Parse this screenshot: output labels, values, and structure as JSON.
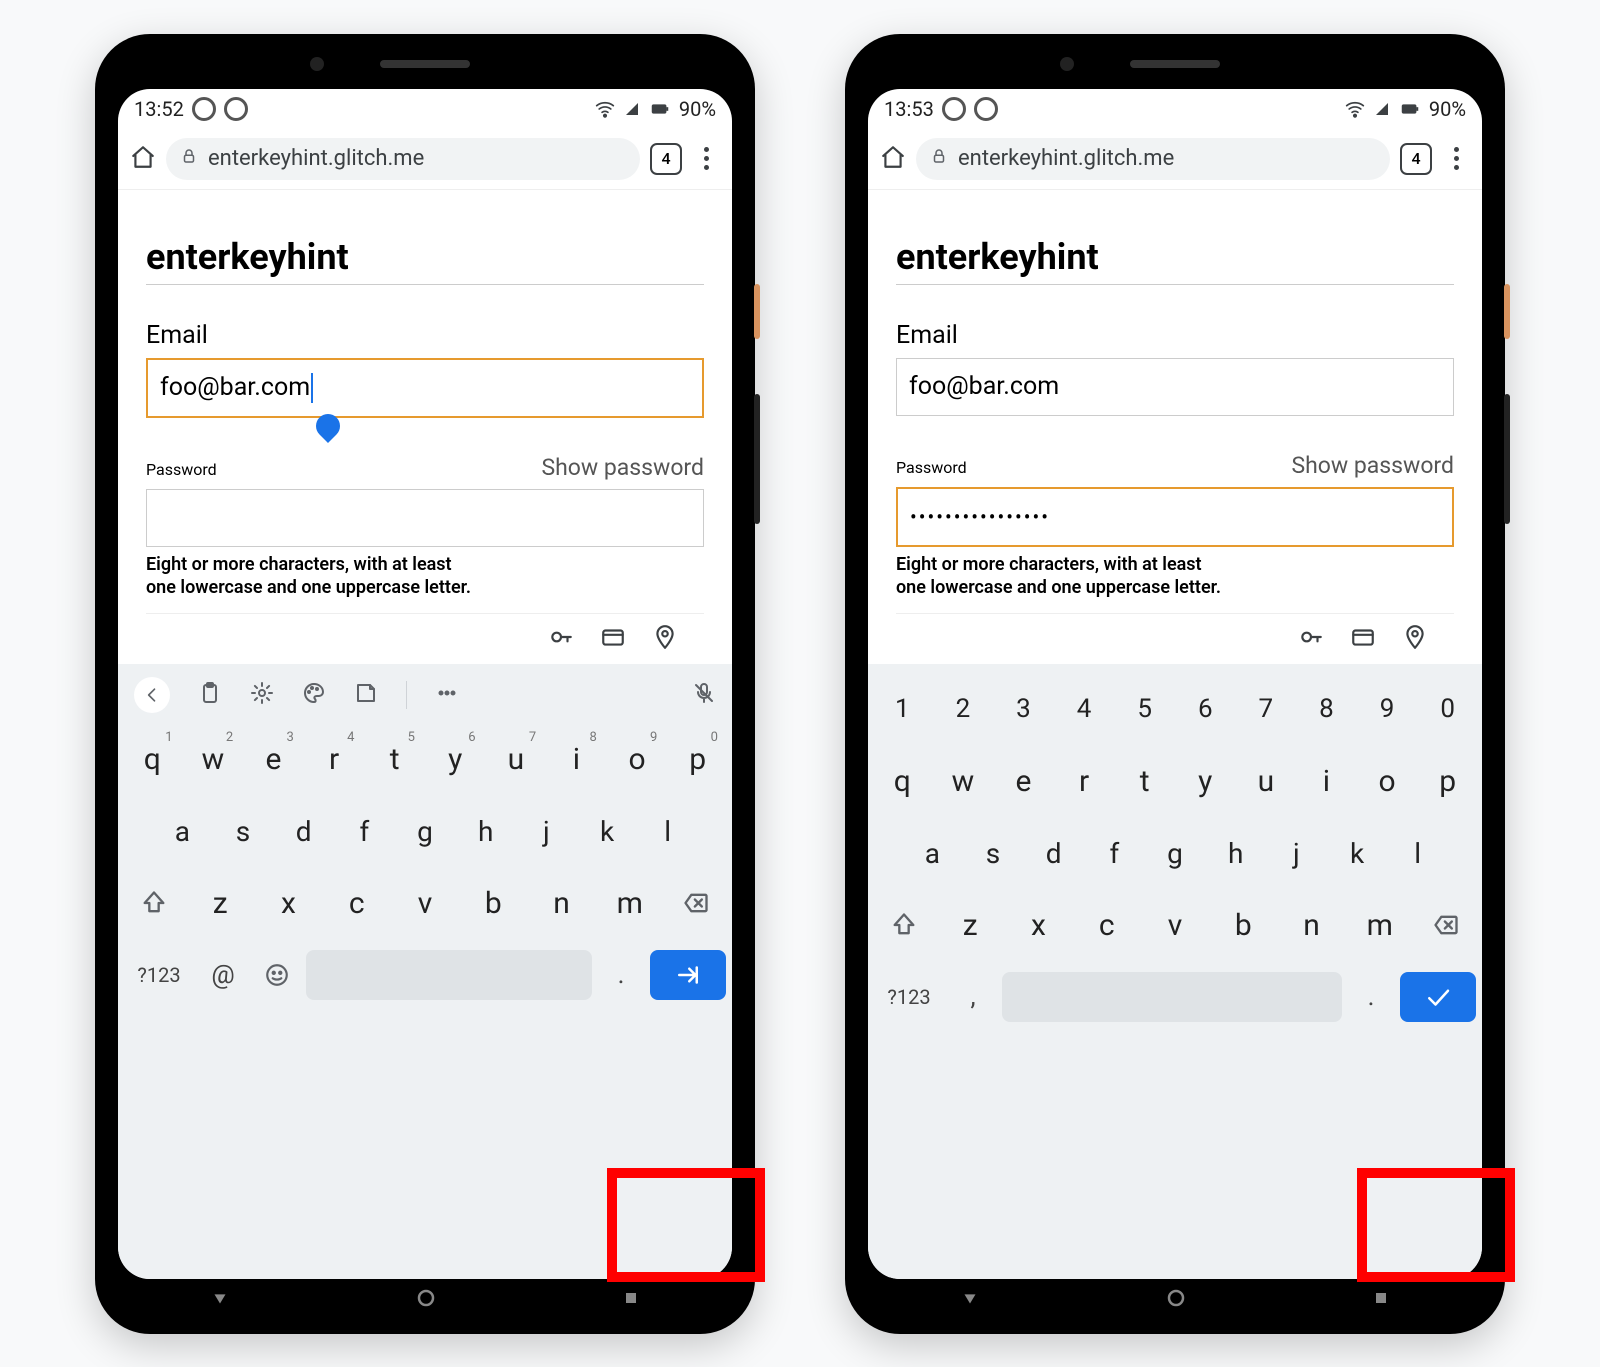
{
  "phones": [
    {
      "status": {
        "time": "13:52",
        "battery": "90%"
      },
      "toolbar": {
        "url": "enterkeyhint.glitch.me",
        "tab_count": "4"
      },
      "page": {
        "title": "enterkeyhint",
        "email_label": "Email",
        "email_value": "foo@bar.com",
        "password_label": "Password",
        "show_password": "Show password",
        "password_value": "",
        "password_hint_l1": "Eight or more characters, with at least",
        "password_hint_l2": "one lowercase and one uppercase letter.",
        "email_active": true,
        "password_active": false
      },
      "keyboard": {
        "mode": "email",
        "row1": [
          {
            "k": "q",
            "s": "1"
          },
          {
            "k": "w",
            "s": "2"
          },
          {
            "k": "e",
            "s": "3"
          },
          {
            "k": "r",
            "s": "4"
          },
          {
            "k": "t",
            "s": "5"
          },
          {
            "k": "y",
            "s": "6"
          },
          {
            "k": "u",
            "s": "7"
          },
          {
            "k": "i",
            "s": "8"
          },
          {
            "k": "o",
            "s": "9"
          },
          {
            "k": "p",
            "s": "0"
          }
        ],
        "row2": [
          "a",
          "s",
          "d",
          "f",
          "g",
          "h",
          "j",
          "k",
          "l"
        ],
        "row3": [
          "z",
          "x",
          "c",
          "v",
          "b",
          "n",
          "m"
        ],
        "sym_label": "?123",
        "left_mini": "@",
        "right_mini": ".",
        "enter_icon": "next"
      }
    },
    {
      "status": {
        "time": "13:53",
        "battery": "90%"
      },
      "toolbar": {
        "url": "enterkeyhint.glitch.me",
        "tab_count": "4"
      },
      "page": {
        "title": "enterkeyhint",
        "email_label": "Email",
        "email_value": "foo@bar.com",
        "password_label": "Password",
        "show_password": "Show password",
        "password_value": "••••••••••••••••",
        "password_hint_l1": "Eight or more characters, with at least",
        "password_hint_l2": "one lowercase and one uppercase letter.",
        "email_active": false,
        "password_active": true
      },
      "keyboard": {
        "mode": "password",
        "num_row": [
          "1",
          "2",
          "3",
          "4",
          "5",
          "6",
          "7",
          "8",
          "9",
          "0"
        ],
        "row1": [
          {
            "k": "q"
          },
          {
            "k": "w"
          },
          {
            "k": "e"
          },
          {
            "k": "r"
          },
          {
            "k": "t"
          },
          {
            "k": "y"
          },
          {
            "k": "u"
          },
          {
            "k": "i"
          },
          {
            "k": "o"
          },
          {
            "k": "p"
          }
        ],
        "row2": [
          "a",
          "s",
          "d",
          "f",
          "g",
          "h",
          "j",
          "k",
          "l"
        ],
        "row3": [
          "z",
          "x",
          "c",
          "v",
          "b",
          "n",
          "m"
        ],
        "sym_label": "?123",
        "left_mini": ",",
        "right_mini": ".",
        "enter_icon": "done"
      }
    }
  ]
}
